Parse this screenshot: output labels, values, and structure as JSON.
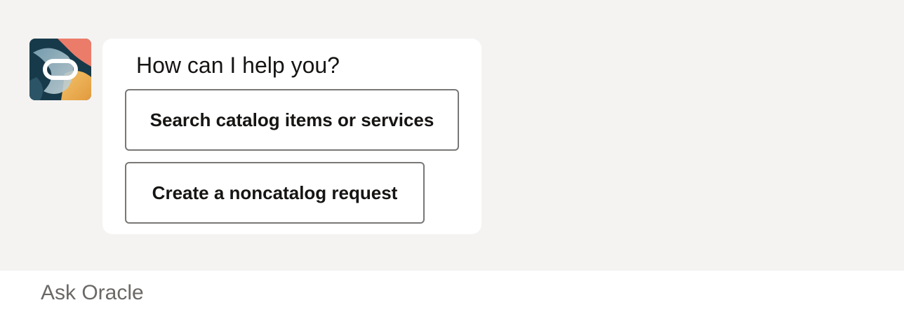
{
  "assistant": {
    "avatar_icon": "oracle-logo-icon",
    "prompt": "How can I help you?"
  },
  "actions": [
    {
      "label": "Search catalog items or services"
    },
    {
      "label": "Create a noncatalog request"
    }
  ],
  "input": {
    "placeholder": "Ask Oracle",
    "value": ""
  },
  "colors": {
    "chat_background": "#f4f3f2",
    "bubble_background": "#ffffff",
    "button_border": "#7a7876",
    "text": "#161513",
    "placeholder": "#6b6966"
  }
}
